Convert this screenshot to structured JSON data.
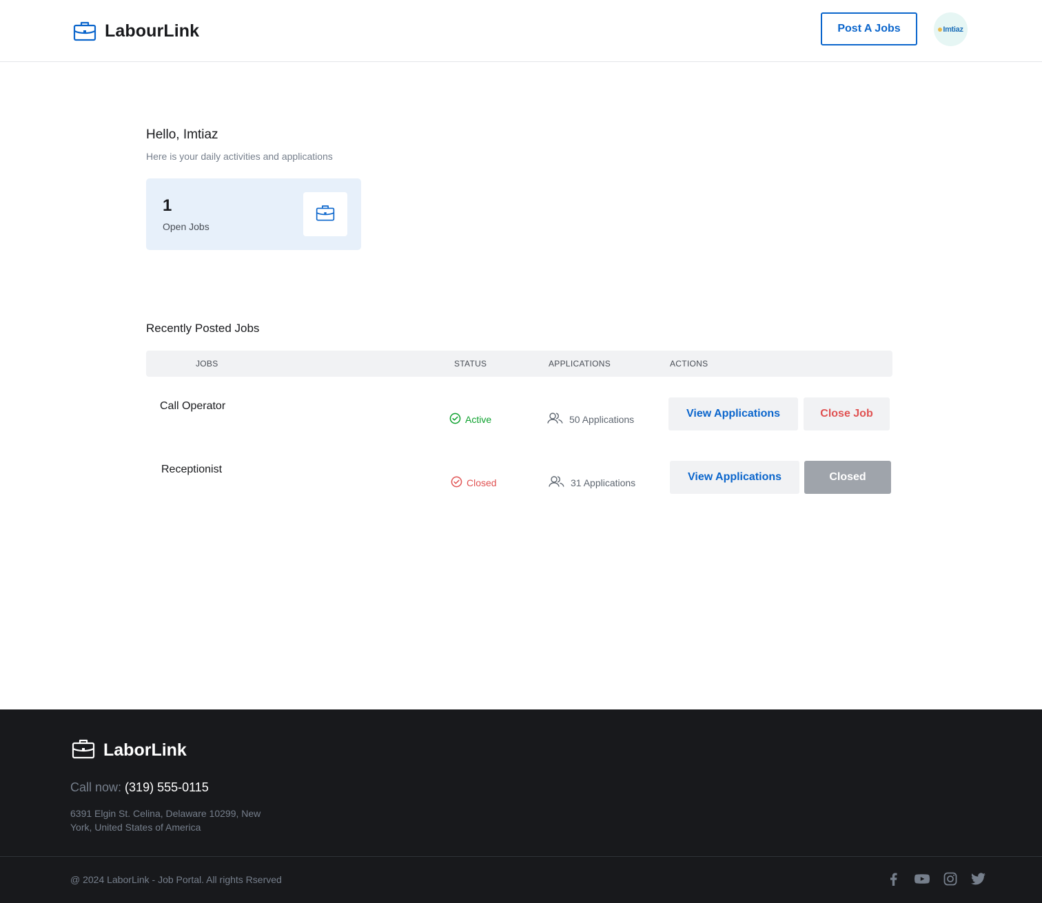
{
  "header": {
    "brand": "LabourLink",
    "post_button": "Post A Jobs",
    "avatar_text": "Imtiaz"
  },
  "greeting": {
    "title": "Hello, Imtiaz",
    "subtitle": "Here is your daily activities and applications"
  },
  "stats": {
    "open_jobs_count": "1",
    "open_jobs_label": "Open Jobs"
  },
  "recent": {
    "title": "Recently Posted Jobs",
    "columns": [
      "Jobs",
      "Status",
      "Applications",
      "Actions"
    ],
    "rows": [
      {
        "job": "Call Operator",
        "status": "Active",
        "applications": "50 Applications",
        "view_label": "View Applications",
        "action_label": "Close Job"
      },
      {
        "job": "Receptionist",
        "status": "Closed",
        "applications": "31 Applications",
        "view_label": "View Applications",
        "action_label": "Closed"
      }
    ]
  },
  "footer": {
    "brand": "LaborLink",
    "call_label": "Call now:",
    "phone": "(319) 555-0115",
    "address": "6391 Elgin St. Celina, Delaware 10299, New York, United States of America",
    "copyright": "@ 2024 LaborLink  - Job Portal. All rights Rserved",
    "socials": [
      "facebook-icon",
      "youtube-icon",
      "instagram-icon",
      "twitter-icon"
    ]
  },
  "colors": {
    "primary": "#0a65cc",
    "success": "#0ba02c",
    "danger": "#e05151",
    "footer_bg": "#18191c"
  }
}
